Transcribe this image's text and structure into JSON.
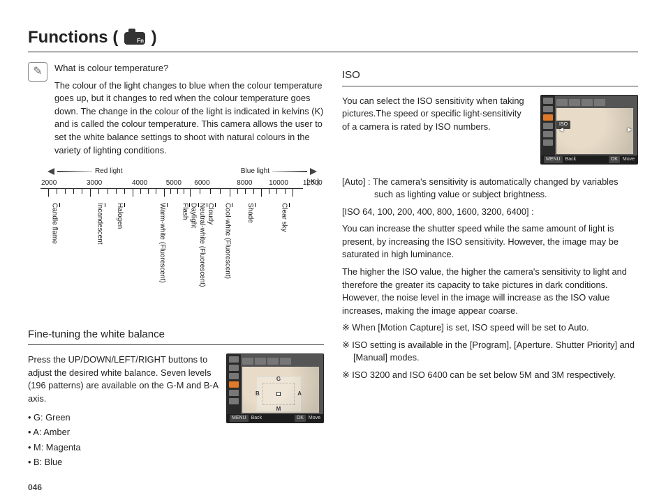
{
  "page": {
    "title_prefix": "Functions (",
    "title_suffix": " )",
    "number": "046"
  },
  "left": {
    "note": {
      "question": "What is colour temperature?",
      "body": "The colour of the light changes to blue when the colour temperature goes up, but it changes to red when the colour temperature goes down. The change in the colour of the light is indicated in kelvins (K) and is called the colour temperature. This camera allows the user to set the white balance settings to shoot with natural colours in the variety of lighting conditions."
    },
    "scale": {
      "red_label": "Red light",
      "blue_label": "Blue light",
      "unit": "[ K ]",
      "k_values": [
        "2000",
        "3000",
        "4000",
        "5000",
        "6000",
        "8000",
        "10000",
        "12000"
      ],
      "k_pos_pct": [
        3,
        19,
        35,
        47,
        57,
        72,
        84,
        96
      ],
      "minor_ticks_pct": [
        3,
        6.2,
        9.4,
        12.6,
        15.8,
        19,
        22.2,
        25.4,
        28.6,
        31.8,
        35,
        38,
        41,
        44,
        47,
        49.5,
        52,
        54.5,
        57,
        60.75,
        64.5,
        68.25,
        72,
        75,
        78,
        81,
        84,
        87,
        90,
        93,
        96
      ],
      "sources": [
        {
          "label": "Candle flame",
          "pos": 3
        },
        {
          "label": "Incandescent",
          "pos": 19
        },
        {
          "label": "Halogen",
          "pos": 26
        },
        {
          "label": "Warm-white (Fluorescent)",
          "pos": 41
        },
        {
          "label": "Flash",
          "pos": 49
        },
        {
          "label": "Daylight",
          "pos": 52
        },
        {
          "label": "Neutral-white (Fluorescent)",
          "pos": 55
        },
        {
          "label": "Cloudy",
          "pos": 58
        },
        {
          "label": "Cool-white (Fluorescent)",
          "pos": 64
        },
        {
          "label": "Shade",
          "pos": 72
        },
        {
          "label": "Clear sky",
          "pos": 84
        }
      ]
    },
    "wb": {
      "heading": "Fine-tuning the white balance",
      "body": "Press the UP/DOWN/LEFT/RIGHT buttons to adjust the desired white balance. Seven levels (196 patterns) are available on the G-M and B-A axis.",
      "items": [
        "• G: Green",
        "• A: Amber",
        "• M: Magenta",
        "• B: Blue"
      ],
      "grid": {
        "top": "G",
        "right": "A",
        "bottom": "M",
        "left": "B"
      },
      "lcd": {
        "back": "Back",
        "move": "Move",
        "menu": "MENU",
        "ok": "OK"
      }
    }
  },
  "right": {
    "iso": {
      "heading": "ISO",
      "intro": "You can select the ISO sensitivity when taking pictures.The speed or specific light-sensitivity of a camera is rated by ISO numbers.",
      "lcd_badge": "ISO",
      "lcd": {
        "back": "Back",
        "move": "Move",
        "menu": "MENU",
        "ok": "OK",
        "left": "◄",
        "right": "►"
      },
      "auto_label": "[Auto] :",
      "auto_text": "The camera's sensitivity is automatically changed by variables such as lighting value or subject brightness.",
      "list_label": "[ISO 64, 100, 200, 400, 800, 1600, 3200, 6400] :",
      "list_body1": "You can increase the shutter speed while the same amount of light is present, by increasing the ISO sensitivity. However, the image may be saturated in high luminance.",
      "list_body2": "The higher the ISO value, the higher the camera's sensitivity to light and therefore the greater its capacity to take pictures in dark conditions. However, the noise level in the image will increase as the ISO value increases, making the image appear coarse.",
      "notes": [
        "※ When [Motion Capture] is set, ISO speed will be set to Auto.",
        "※ ISO setting is available in the [Program], [Aperture. Shutter Priority] and [Manual] modes.",
        "※ ISO 3200 and ISO 6400 can be set below 5M and 3M respectively."
      ]
    }
  }
}
